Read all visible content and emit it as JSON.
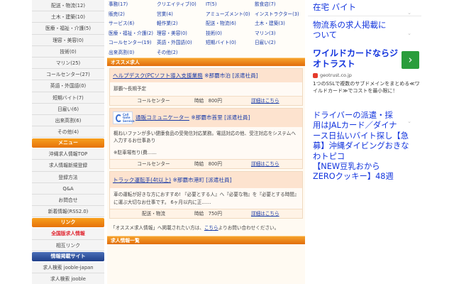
{
  "sidebar": {
    "top_items": [
      "配送・物流(12)",
      "土木・建築(10)",
      "医療・福祉・介護(5)",
      "理容・美容(0)",
      "技術(0)",
      "マリン(25)",
      "コールセンター(27)",
      "英語・外国語(0)",
      "短期バイト(7)",
      "日雇い(6)",
      "出来高割(6)",
      "その他(4)"
    ],
    "menu_header": "メニュー",
    "menu_items": [
      "沖縄求人情報TOP",
      "求人情報新規登録",
      "登録方法",
      "Q&A",
      "お問合せ",
      "新着情報(RSS2.0)"
    ],
    "link_header": "リンク",
    "link_items": [
      "全国版求人情報",
      "相互リンク"
    ],
    "site_header": "情報掲載サイト",
    "site_items": [
      "求人検索 jooble-japan",
      "求人検索 jooble"
    ]
  },
  "main": {
    "categories": [
      [
        "事務(17)",
        "クリエイティブ(0)",
        "IT(5)",
        "飲食店(7)"
      ],
      [
        "販売(2)",
        "営業(4)",
        "アミューズメント(0)",
        "インストラクター(3)"
      ],
      [
        "サービス(6)",
        "軽作業(2)",
        "配送・物流(6)",
        "土木・建築(3)"
      ],
      [
        "医療・福祉・介護(2)",
        "理容・美容(0)",
        "技術(0)",
        "マリン(3)"
      ],
      [
        "コールセンター(19)",
        "英語・外国語(0)",
        "短期バイト(0)",
        "日雇い(2)"
      ],
      [
        "出来高割(0)",
        "その他(2)",
        "",
        ""
      ]
    ],
    "recommend_header": "オススメ求人",
    "jobs": [
      {
        "title": "ヘルプデスク(PCソフト導入支援業務",
        "location": "※那覇市泊 [派遣社員]",
        "desc": "那覇～長期予定",
        "industry": "コールセンター",
        "pay": "時給　800円",
        "more": "詳細はこちら"
      },
      {
        "logo_text": "Call Gate Service",
        "title": "通販コミュニケーター",
        "location": "※那覇市首里 [派遣社員]",
        "desc": "概ねいファンが多い健康食品の受発信対応業務。電話対応の他、受注対応をシステムへ入力するお仕事あり",
        "desc2": "※駐車場有り(費……",
        "industry": "コールセンター",
        "pay": "時給　800円",
        "more": "詳細はこちら"
      },
      {
        "title": "トラック運転手(4t以上)",
        "location": "※那覇市港町 [派遣社員]",
        "desc": "車の運転が好きな方におすすめ! 『必要とする人』へ『必要な物』を『必要とする時間』に運ぶ大切なお仕事です。 6ヶ月以内に正……",
        "industry": "配送・物流",
        "pay": "時給　750円",
        "more": "詳細はこちら"
      }
    ],
    "note_prefix": "「オススメ求人情報」へ掲載されたい方は、",
    "note_link": "こちら",
    "note_suffix": "よりお問い合わせください。",
    "list_header": "求人情報一覧"
  },
  "ads": {
    "top_links": [
      "在宅 バイト",
      "物流系の求人掲載に",
      "ついて"
    ],
    "wild_title": "ワイルドカードならジオトラスト",
    "wild_site": "geotrust.co.jp",
    "wild_desc": "1つのSSLで複数のサブドメインをまとめる≪ワイルドカード≫でコストを最小限に！",
    "wild_button": "›",
    "links2": [
      "ドライバーの派遣・採",
      "用はJALカード／ダイナ",
      "ース日払いバイト探し【急",
      "募】沖縄ダイビングおきな",
      "わトピコ",
      "【NEW豆乳おから",
      "ZEROクッキー】48週"
    ],
    "chevron": "⌄"
  },
  "colors": {
    "accent_orange": "#e6720a",
    "link_blue": "#1a3ca8",
    "ad_blue": "#1133dd",
    "go_green": "#2a9d3c"
  }
}
